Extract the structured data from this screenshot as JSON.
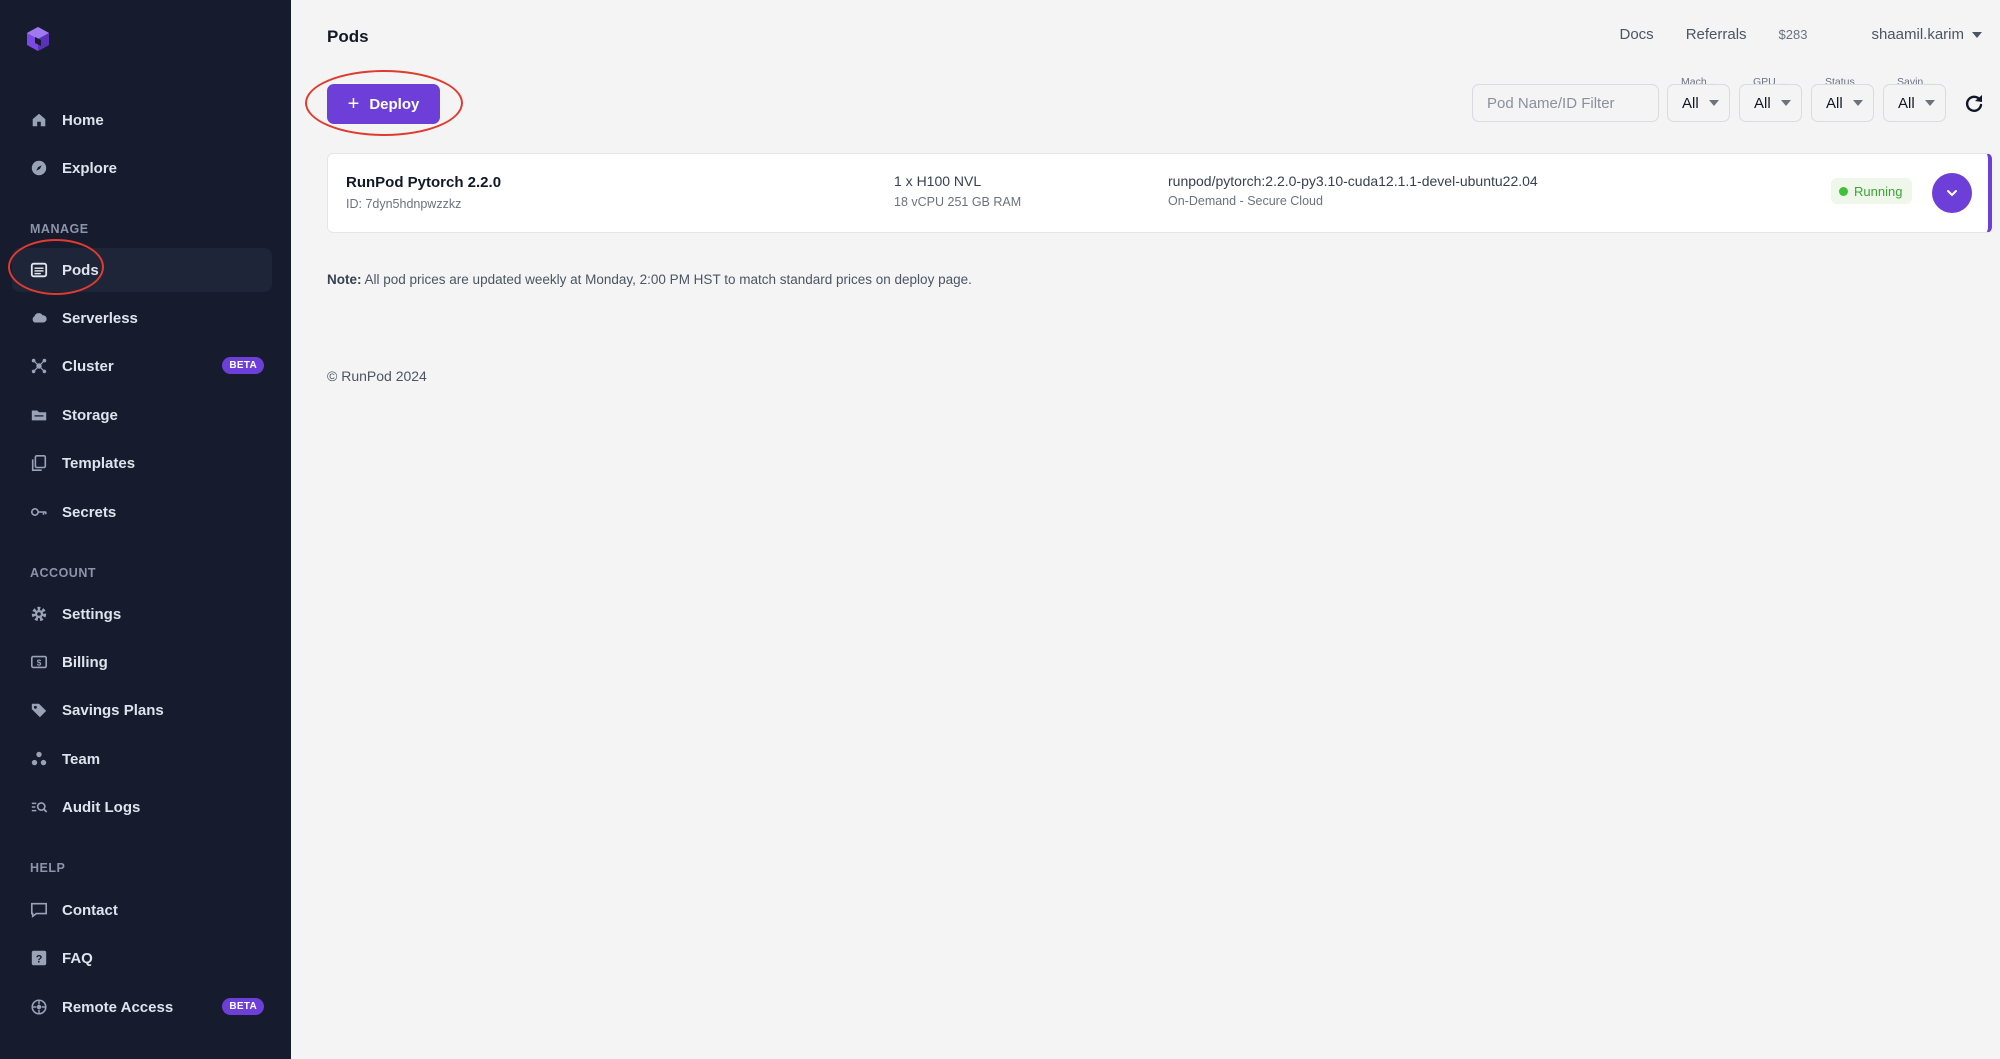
{
  "sidebar": {
    "top_items": [
      {
        "label": "Home",
        "icon": "home-icon"
      },
      {
        "label": "Explore",
        "icon": "compass-icon"
      }
    ],
    "manage_label": "MANAGE",
    "manage_items": [
      {
        "label": "Pods",
        "icon": "pods-icon",
        "active": true
      },
      {
        "label": "Serverless",
        "icon": "cloud-icon"
      },
      {
        "label": "Cluster",
        "icon": "cluster-icon",
        "badge": "BETA"
      },
      {
        "label": "Storage",
        "icon": "storage-icon"
      },
      {
        "label": "Templates",
        "icon": "templates-icon"
      },
      {
        "label": "Secrets",
        "icon": "key-icon"
      }
    ],
    "account_label": "ACCOUNT",
    "account_items": [
      {
        "label": "Settings",
        "icon": "gear-icon"
      },
      {
        "label": "Billing",
        "icon": "billing-icon"
      },
      {
        "label": "Savings Plans",
        "icon": "tag-icon"
      },
      {
        "label": "Team",
        "icon": "team-icon"
      },
      {
        "label": "Audit Logs",
        "icon": "audit-icon"
      }
    ],
    "help_label": "HELP",
    "help_items": [
      {
        "label": "Contact",
        "icon": "chat-icon"
      },
      {
        "label": "FAQ",
        "icon": "question-icon"
      },
      {
        "label": "Remote Access",
        "icon": "remote-icon",
        "badge": "BETA"
      }
    ]
  },
  "header": {
    "title": "Pods",
    "docs": "Docs",
    "referrals": "Referrals",
    "balance": "$283",
    "user": "shaamil.karim"
  },
  "toolbar": {
    "deploy_label": "Deploy",
    "filter_placeholder": "Pod Name/ID Filter",
    "filters": [
      {
        "label": "Mach...",
        "value": "All"
      },
      {
        "label": "GPU ...",
        "value": "All"
      },
      {
        "label": "Status",
        "value": "All"
      },
      {
        "label": "Savin...",
        "value": "All"
      }
    ]
  },
  "pods": [
    {
      "name": "RunPod Pytorch 2.2.0",
      "id": "ID: 7dyn5hdnpwzzkz",
      "gpu": "1 x H100 NVL",
      "spec": "18 vCPU 251 GB RAM",
      "image": "runpod/pytorch:2.2.0-py3.10-cuda12.1.1-devel-ubuntu22.04",
      "cloud": "On-Demand - Secure Cloud",
      "status": "Running"
    }
  ],
  "note": {
    "label": "Note:",
    "text": " All pod prices are updated weekly at Monday, 2:00 PM HST to match standard prices on deploy page."
  },
  "footer": {
    "copyright": "© RunPod 2024"
  },
  "colors": {
    "accent": "#6d3fd8",
    "sidebar": "#161b2e",
    "annotation": "#e03b2f",
    "running": "#3fbf3a"
  }
}
